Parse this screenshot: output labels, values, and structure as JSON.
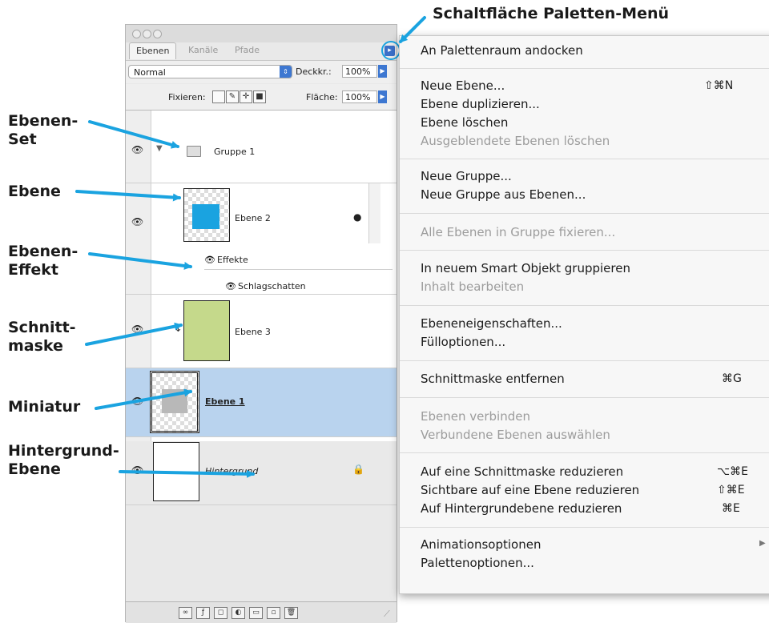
{
  "annotations": {
    "title": "Schaltfläche Paletten-Menü",
    "labels": [
      {
        "id": "set",
        "line1": "Ebenen-",
        "line2": "Set"
      },
      {
        "id": "ebene",
        "line1": "Ebene",
        "line2": ""
      },
      {
        "id": "effekt",
        "line1": "Ebenen-",
        "line2": "Effekt"
      },
      {
        "id": "maske",
        "line1": "Schnitt-",
        "line2": "maske"
      },
      {
        "id": "miniatur",
        "line1": "Miniatur",
        "line2": ""
      },
      {
        "id": "hintergrund",
        "line1": "Hintergrund-",
        "line2": "Ebene"
      }
    ]
  },
  "palette": {
    "tabs": [
      "Ebenen",
      "Kanäle",
      "Pfade"
    ],
    "blend_mode": "Normal",
    "opacity_label": "Deckkr.:",
    "opacity_value": "100%",
    "lock_label": "Fixieren:",
    "fill_label": "Fläche:",
    "fill_value": "100%",
    "layers": {
      "group": "Gruppe 1",
      "layer2": "Ebene 2",
      "effects": "Effekte",
      "drop_shadow": "Schlagschatten",
      "layer3": "Ebene 3",
      "layer1": "Ebene 1",
      "background": "Hintergrund"
    },
    "colors": {
      "cyan": "#1aa3e0",
      "green": "#c5d98b",
      "selected": "#b9d3ee",
      "gray": "#b8b8b8"
    }
  },
  "menu": {
    "items": [
      {
        "label": "An Palettenraum andocken",
        "shortcut": "",
        "disabled": false
      },
      {
        "label": "Neue Ebene...",
        "shortcut": "⇧⌘N",
        "disabled": false
      },
      {
        "label": "Ebene duplizieren...",
        "shortcut": "",
        "disabled": false
      },
      {
        "label": "Ebene löschen",
        "shortcut": "",
        "disabled": false
      },
      {
        "label": "Ausgeblendete Ebenen löschen",
        "shortcut": "",
        "disabled": true
      },
      {
        "label": "Neue Gruppe...",
        "shortcut": "",
        "disabled": false
      },
      {
        "label": "Neue Gruppe aus Ebenen...",
        "shortcut": "",
        "disabled": false
      },
      {
        "label": "Alle Ebenen in Gruppe fixieren...",
        "shortcut": "",
        "disabled": true
      },
      {
        "label": "In neuem Smart Objekt gruppieren",
        "shortcut": "",
        "disabled": false
      },
      {
        "label": "Inhalt bearbeiten",
        "shortcut": "",
        "disabled": true
      },
      {
        "label": "Ebeneneigenschaften...",
        "shortcut": "",
        "disabled": false
      },
      {
        "label": "Fülloptionen...",
        "shortcut": "",
        "disabled": false
      },
      {
        "label": "Schnittmaske entfernen",
        "shortcut": "⌘G",
        "disabled": false
      },
      {
        "label": "Ebenen verbinden",
        "shortcut": "",
        "disabled": true
      },
      {
        "label": "Verbundene Ebenen auswählen",
        "shortcut": "",
        "disabled": true
      },
      {
        "label": "Auf eine Schnittmaske reduzieren",
        "shortcut": "⌥⌘E",
        "disabled": false
      },
      {
        "label": "Sichtbare auf eine Ebene reduzieren",
        "shortcut": "⇧⌘E",
        "disabled": false
      },
      {
        "label": "Auf Hintergrundebene reduzieren",
        "shortcut": "⌘E",
        "disabled": false
      },
      {
        "label": "Animationsoptionen",
        "shortcut": "▶",
        "disabled": false
      },
      {
        "label": "Palettenoptionen...",
        "shortcut": "",
        "disabled": false
      }
    ]
  }
}
